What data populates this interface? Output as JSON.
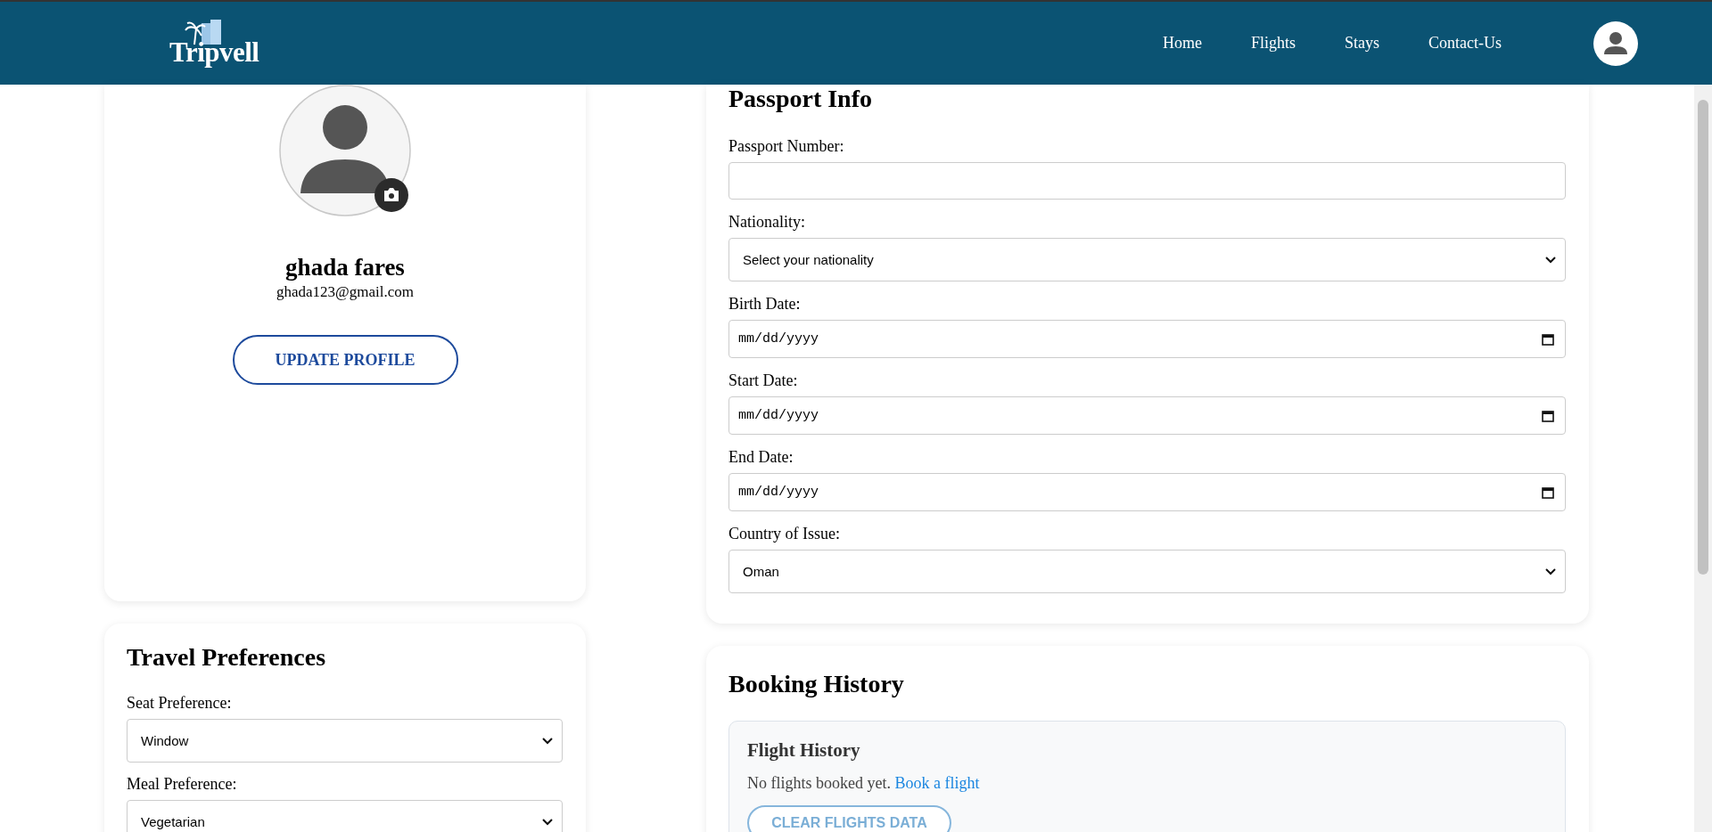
{
  "header": {
    "logo": "Tripvell",
    "nav": [
      {
        "label": "Home"
      },
      {
        "label": "Flights"
      },
      {
        "label": "Stays"
      },
      {
        "label": "Contact-Us"
      }
    ]
  },
  "profile": {
    "name": "ghada fares",
    "email": "ghada123@gmail.com",
    "button": "UPDATE PROFILE"
  },
  "travel_preferences": {
    "title": "Travel Preferences",
    "fields": [
      {
        "label": "Seat Preference:",
        "kind": "select",
        "value": "Window"
      },
      {
        "label": "Meal Preference:",
        "kind": "select",
        "value": "Vegetarian"
      }
    ]
  },
  "passport": {
    "title": "Passport Info",
    "fields": [
      {
        "label": "Passport Number:",
        "kind": "text"
      },
      {
        "label": "Nationality:",
        "kind": "select",
        "value": "Select your nationality"
      },
      {
        "label": "Birth Date:",
        "kind": "date",
        "placeholder": "mm/dd/yyyy"
      },
      {
        "label": "Start Date:",
        "kind": "date",
        "placeholder": "mm/dd/yyyy"
      },
      {
        "label": "End Date:",
        "kind": "date",
        "placeholder": "mm/dd/yyyy"
      },
      {
        "label": "Country of Issue:",
        "kind": "select",
        "value": "Oman"
      }
    ]
  },
  "booking_history": {
    "title": "Booking History",
    "flight_history": {
      "title": "Flight History",
      "message": "No flights booked yet.",
      "link": "Book a flight",
      "button": "CLEAR FLIGHTS DATA"
    }
  }
}
